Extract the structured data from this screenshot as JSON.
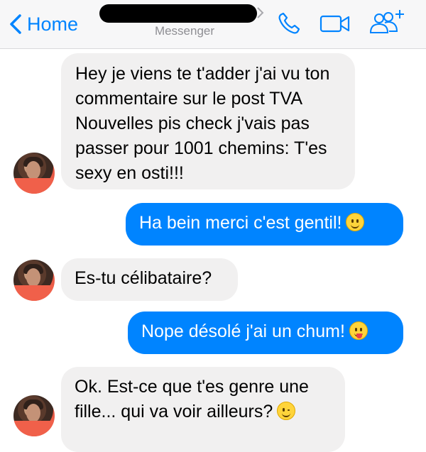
{
  "header": {
    "back_label": "Home",
    "subtitle": "Messenger",
    "icons": [
      "chevron-left-icon",
      "phone-icon",
      "video-camera-icon",
      "add-people-icon"
    ]
  },
  "messages": [
    {
      "side": "in",
      "text": "Hey je viens te t'adder j'ai vu ton commentaire sur le post TVA Nouvelles pis check j'vais pas passer pour 1001 chemins: T'es sexy en osti!!!"
    },
    {
      "side": "out",
      "text": "Ha bein merci c'est gentil!",
      "emoji": "smile"
    },
    {
      "side": "in",
      "text": "Es-tu célibataire?"
    },
    {
      "side": "out",
      "text": "Nope désolé j'ai un chum!",
      "emoji": "tongue"
    },
    {
      "side": "in",
      "text": "Ok. Est-ce que t'es genre une fille... qui va voir ailleurs?",
      "emoji": "wink"
    }
  ],
  "colors": {
    "accent": "#0084ff",
    "incoming_bubble": "#f1f0f0"
  }
}
